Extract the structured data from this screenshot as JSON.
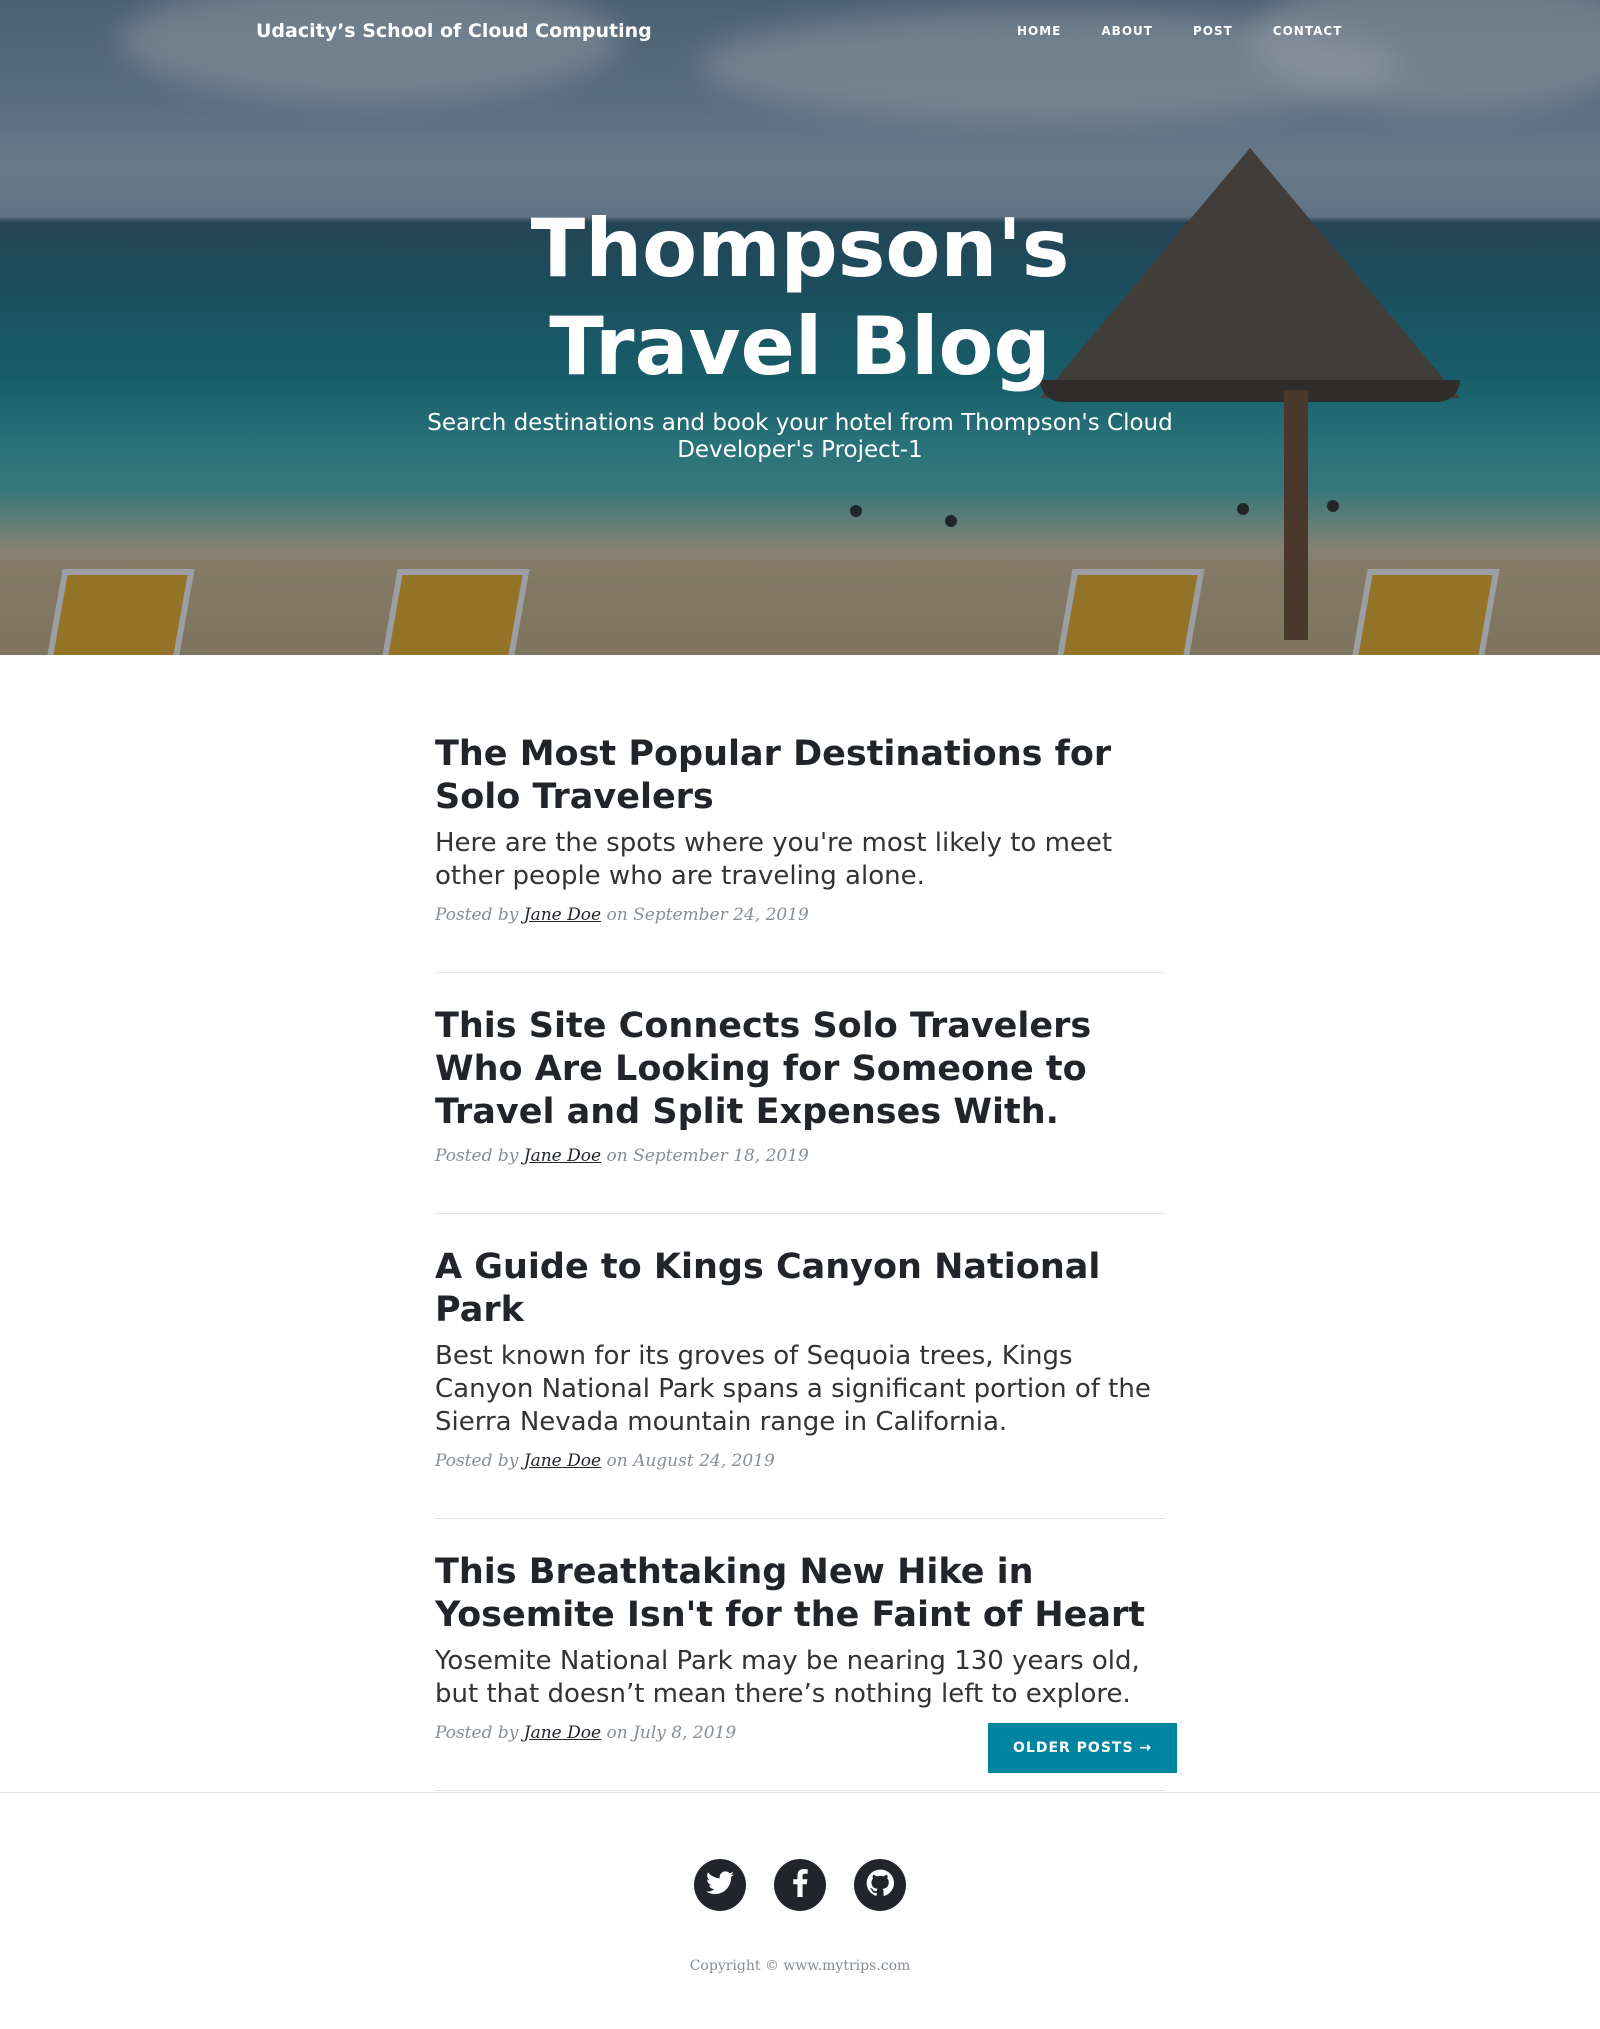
{
  "nav": {
    "brand": "Udacity’s School of Cloud Computing",
    "links": [
      "HOME",
      "ABOUT",
      "POST",
      "CONTACT"
    ]
  },
  "hero": {
    "title": "Thompson's Travel Blog",
    "subtitle": "Search destinations and book your hotel from Thompson's Cloud Developer's Project-1"
  },
  "posts": [
    {
      "title": "The Most Popular Destinations for Solo Travelers",
      "subtitle": "Here are the spots where you're most likely to meet other people who are traveling alone.",
      "posted_by": "Posted by",
      "author": "Jane Doe",
      "on": "on September 24, 2019"
    },
    {
      "title": "This Site Connects Solo Travelers Who Are Looking for Someone to Travel and Split Expenses With.",
      "subtitle": "",
      "posted_by": "Posted by",
      "author": "Jane Doe",
      "on": "on September 18, 2019"
    },
    {
      "title": "A Guide to Kings Canyon National Park",
      "subtitle": "Best known for its groves of Sequoia trees, Kings Canyon National Park spans a significant portion of the Sierra Nevada mountain range in California.",
      "posted_by": "Posted by",
      "author": "Jane Doe",
      "on": "on August 24, 2019"
    },
    {
      "title": "This Breathtaking New Hike in Yosemite Isn't for the Faint of Heart",
      "subtitle": "Yosemite National Park may be nearing 130 years old, but that doesn’t mean there’s nothing left to explore.",
      "posted_by": "Posted by",
      "author": "Jane Doe",
      "on": "on July 8, 2019"
    }
  ],
  "pager": {
    "older_label": "OLDER POSTS →"
  },
  "footer": {
    "social_icons": [
      "twitter-icon",
      "facebook-icon",
      "github-icon"
    ],
    "copyright": "Copyright © www.mytrips.com"
  },
  "colors": {
    "accent": "#0085a1",
    "text": "#212529",
    "meta": "#868e96"
  }
}
